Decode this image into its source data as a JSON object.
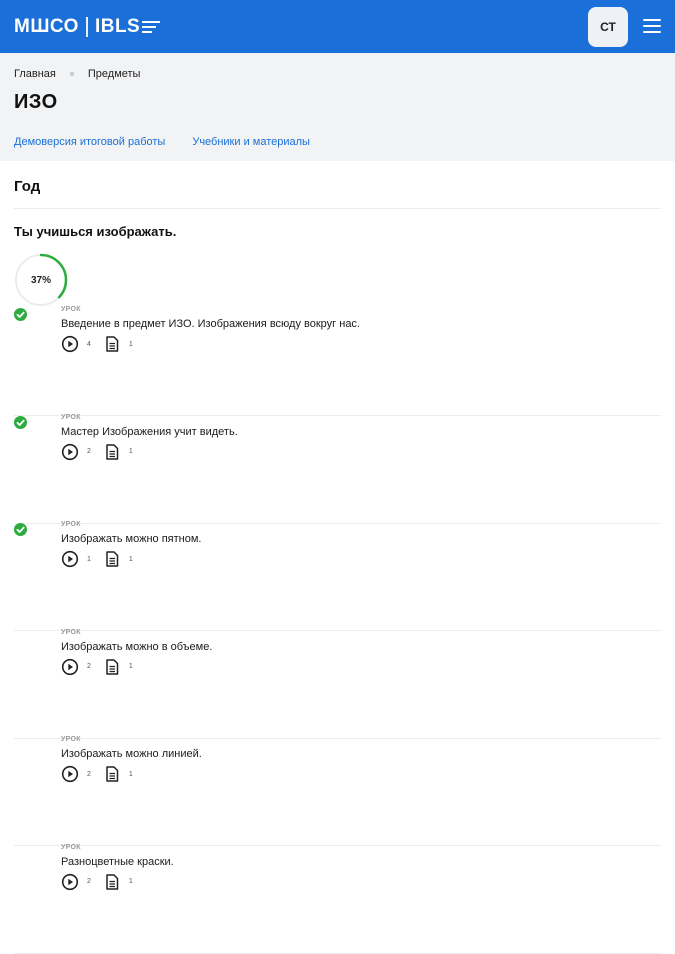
{
  "header": {
    "logo_left": "МШСО",
    "logo_right": "IBLS",
    "avatar_initials": "СТ",
    "brand_color": "#1a6fd8"
  },
  "breadcrumb": [
    "Главная",
    "Предметы"
  ],
  "page_title": "ИЗО",
  "tabs": [
    "Демоверсия итоговой работы",
    "Учебники и материалы"
  ],
  "section_title": "Год",
  "course_title": "Ты учишься изображать.",
  "progress": {
    "label": "37%",
    "value": 0.37,
    "color": "#2dab3f"
  },
  "lesson_kicker": "УРОК",
  "lessons": [
    {
      "title": "Введение в предмет ИЗО. Изображения всюду вокруг нас.",
      "videos": "4",
      "docs": "1",
      "done": true
    },
    {
      "title": "Мастер Изображения учит видеть.",
      "videos": "2",
      "docs": "1",
      "done": true
    },
    {
      "title": "Изображать можно пятном.",
      "videos": "1",
      "docs": "1",
      "done": true
    },
    {
      "title": "Изображать можно в объеме.",
      "videos": "2",
      "docs": "1",
      "done": false
    },
    {
      "title": "Изображать можно линией.",
      "videos": "2",
      "docs": "1",
      "done": false
    },
    {
      "title": "Разноцветные краски.",
      "videos": "2",
      "docs": "1",
      "done": false
    }
  ],
  "icons": {
    "video": "play-circle-icon",
    "doc": "document-icon",
    "done": "check-circle-icon",
    "menu": "menu-icon"
  }
}
